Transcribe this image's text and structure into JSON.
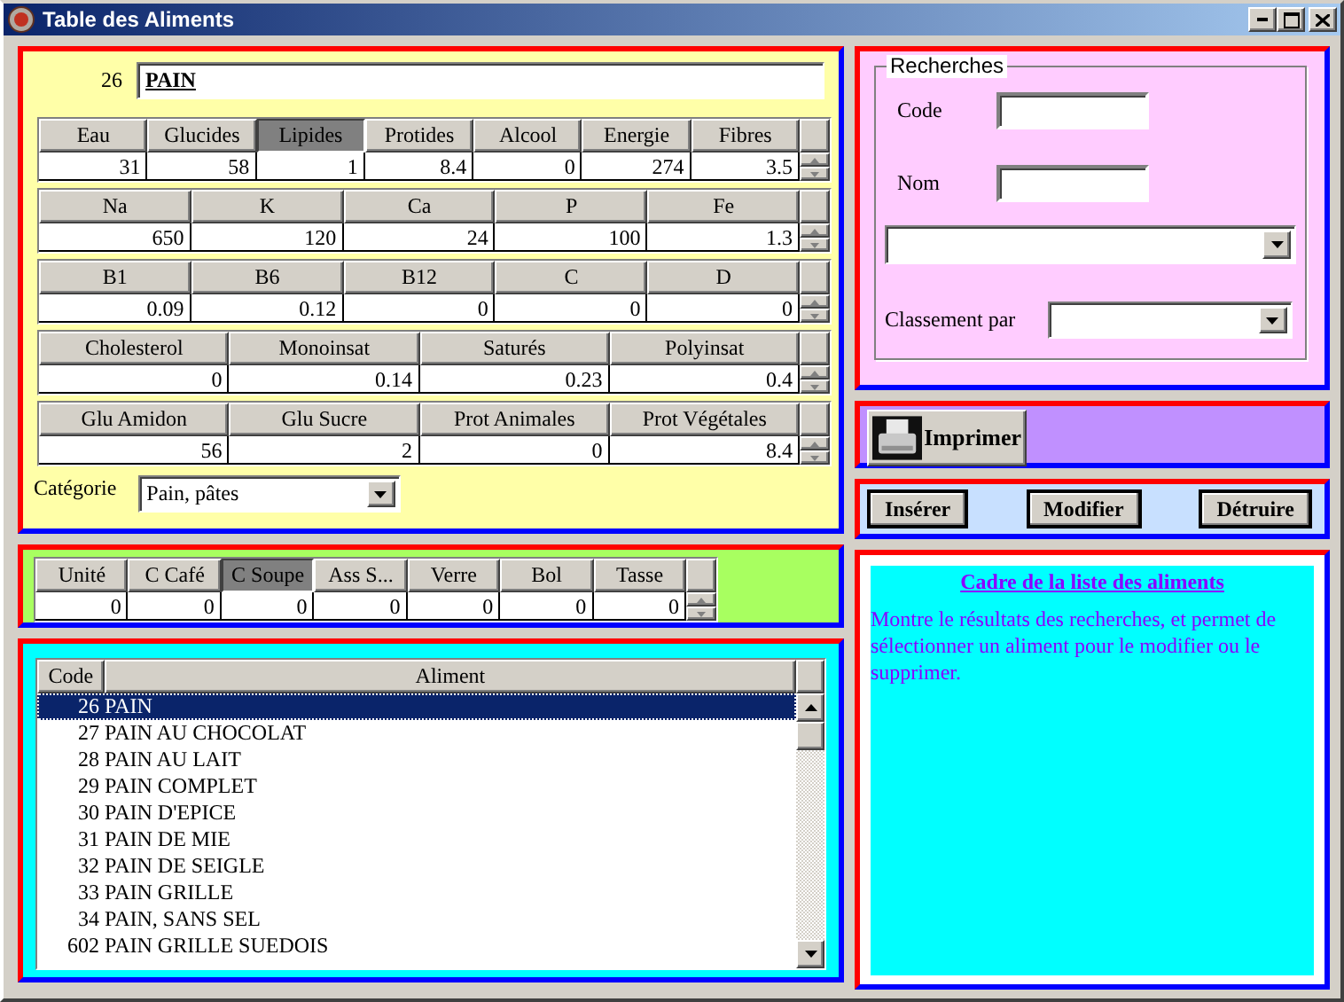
{
  "window": {
    "title": "Table des Aliments"
  },
  "food": {
    "code": "26",
    "name": "PAIN"
  },
  "nutrient_grids": [
    {
      "columns": [
        {
          "label": "Eau",
          "selected": false,
          "value": "31"
        },
        {
          "label": "Glucides",
          "selected": false,
          "value": "58"
        },
        {
          "label": "Lipides",
          "selected": true,
          "value": "1"
        },
        {
          "label": "Protides",
          "selected": false,
          "value": "8.4"
        },
        {
          "label": "Alcool",
          "selected": false,
          "value": "0"
        },
        {
          "label": "Energie",
          "selected": false,
          "value": "274"
        },
        {
          "label": "Fibres",
          "selected": false,
          "value": "3.5"
        }
      ]
    },
    {
      "columns": [
        {
          "label": "Na",
          "selected": false,
          "value": "650"
        },
        {
          "label": "K",
          "selected": false,
          "value": "120"
        },
        {
          "label": "Ca",
          "selected": false,
          "value": "24"
        },
        {
          "label": "P",
          "selected": false,
          "value": "100"
        },
        {
          "label": "Fe",
          "selected": false,
          "value": "1.3"
        }
      ]
    },
    {
      "columns": [
        {
          "label": "B1",
          "selected": false,
          "value": "0.09"
        },
        {
          "label": "B6",
          "selected": false,
          "value": "0.12"
        },
        {
          "label": "B12",
          "selected": false,
          "value": "0"
        },
        {
          "label": "C",
          "selected": false,
          "value": "0"
        },
        {
          "label": "D",
          "selected": false,
          "value": "0"
        }
      ]
    },
    {
      "columns": [
        {
          "label": "Cholesterol",
          "selected": false,
          "value": "0"
        },
        {
          "label": "Monoinsat",
          "selected": false,
          "value": "0.14"
        },
        {
          "label": "Saturés",
          "selected": false,
          "value": "0.23"
        },
        {
          "label": "Polyinsat",
          "selected": false,
          "value": "0.4"
        }
      ]
    },
    {
      "columns": [
        {
          "label": "Glu Amidon",
          "selected": false,
          "value": "56"
        },
        {
          "label": "Glu Sucre",
          "selected": false,
          "value": "2"
        },
        {
          "label": "Prot Animales",
          "selected": false,
          "value": "0"
        },
        {
          "label": "Prot Végétales",
          "selected": false,
          "value": "8.4"
        }
      ]
    }
  ],
  "category": {
    "label": "Catégorie",
    "value": "Pain, pâtes"
  },
  "portions": {
    "columns": [
      {
        "label": "Unité",
        "selected": false,
        "value": "0"
      },
      {
        "label": "C Café",
        "selected": false,
        "value": "0"
      },
      {
        "label": "C Soupe",
        "selected": true,
        "value": "0"
      },
      {
        "label": "Ass S...",
        "selected": false,
        "value": "0"
      },
      {
        "label": "Verre",
        "selected": false,
        "value": "0"
      },
      {
        "label": "Bol",
        "selected": false,
        "value": "0"
      },
      {
        "label": "Tasse",
        "selected": false,
        "value": "0"
      }
    ]
  },
  "food_list": {
    "columns": [
      "Code",
      "Aliment"
    ],
    "rows": [
      {
        "code": "26",
        "name": "PAIN",
        "selected": true
      },
      {
        "code": "27",
        "name": "PAIN AU CHOCOLAT",
        "selected": false
      },
      {
        "code": "28",
        "name": "PAIN AU LAIT",
        "selected": false
      },
      {
        "code": "29",
        "name": "PAIN COMPLET",
        "selected": false
      },
      {
        "code": "30",
        "name": "PAIN D'EPICE",
        "selected": false
      },
      {
        "code": "31",
        "name": "PAIN DE MIE",
        "selected": false
      },
      {
        "code": "32",
        "name": "PAIN DE SEIGLE",
        "selected": false
      },
      {
        "code": "33",
        "name": "PAIN GRILLE",
        "selected": false
      },
      {
        "code": "34",
        "name": "PAIN, SANS SEL",
        "selected": false
      },
      {
        "code": "602",
        "name": "PAIN GRILLE SUEDOIS",
        "selected": false
      }
    ]
  },
  "search": {
    "title": "Recherches",
    "code_label": "Code",
    "name_label": "Nom",
    "sort_label": "Classement par"
  },
  "print_button": "Imprimer",
  "action_buttons": [
    "Insérer",
    "Modifier",
    "Détruire"
  ],
  "help": {
    "title": "Cadre de la liste des aliments",
    "text": "Montre le résultats des recherches, et permet de sélectionner un aliment pour le modifier ou le supprimer."
  }
}
